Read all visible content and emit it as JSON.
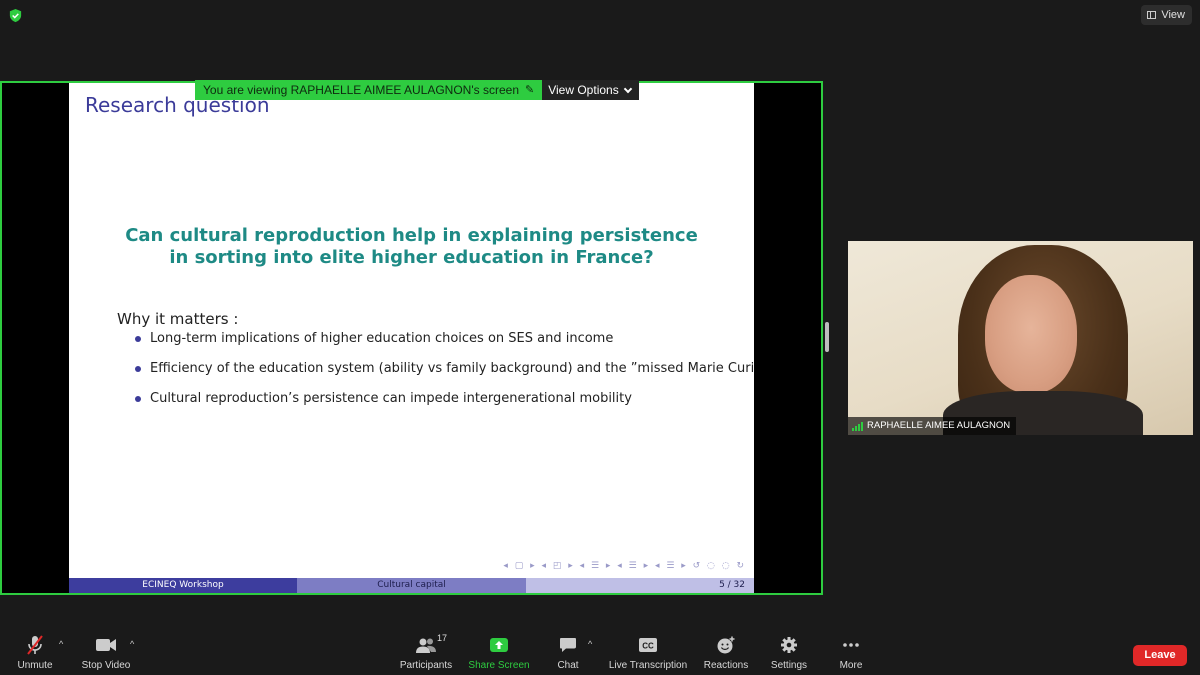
{
  "topbar": {
    "view_label": "View"
  },
  "share": {
    "banner_text": "You are viewing RAPHAELLE AIMEE AULAGNON's screen",
    "view_options_label": "View Options"
  },
  "slide": {
    "title": "Research question",
    "question_line1": "Can cultural reproduction help in explaining persistence",
    "question_line2": "in sorting into elite higher education in France?",
    "matters_heading": "Why it matters :",
    "bullets": [
      "Long-term implications of higher education choices on SES and income",
      "Efficiency of the education system (ability vs family background) and the ”missed Marie Curie”",
      "Cultural reproduction’s persistence can impede intergenerational mobility"
    ],
    "footer_left": "ECINEQ Workshop",
    "footer_center": "Cultural capital",
    "footer_page": "5 / 32"
  },
  "video": {
    "participant_name": "RAPHAELLE AIMEE AULAGNON"
  },
  "toolbar": {
    "unmute_label": "Unmute",
    "stop_video_label": "Stop Video",
    "participants_label": "Participants",
    "participants_count": "17",
    "share_screen_label": "Share Screen",
    "chat_label": "Chat",
    "live_transcription_label": "Live Transcription",
    "reactions_label": "Reactions",
    "settings_label": "Settings",
    "more_label": "More",
    "leave_label": "Leave"
  },
  "colors": {
    "share_green": "#2ecc40",
    "slide_title": "#3b3b99",
    "question_teal": "#1e8a85",
    "leave_red": "#e02828"
  }
}
